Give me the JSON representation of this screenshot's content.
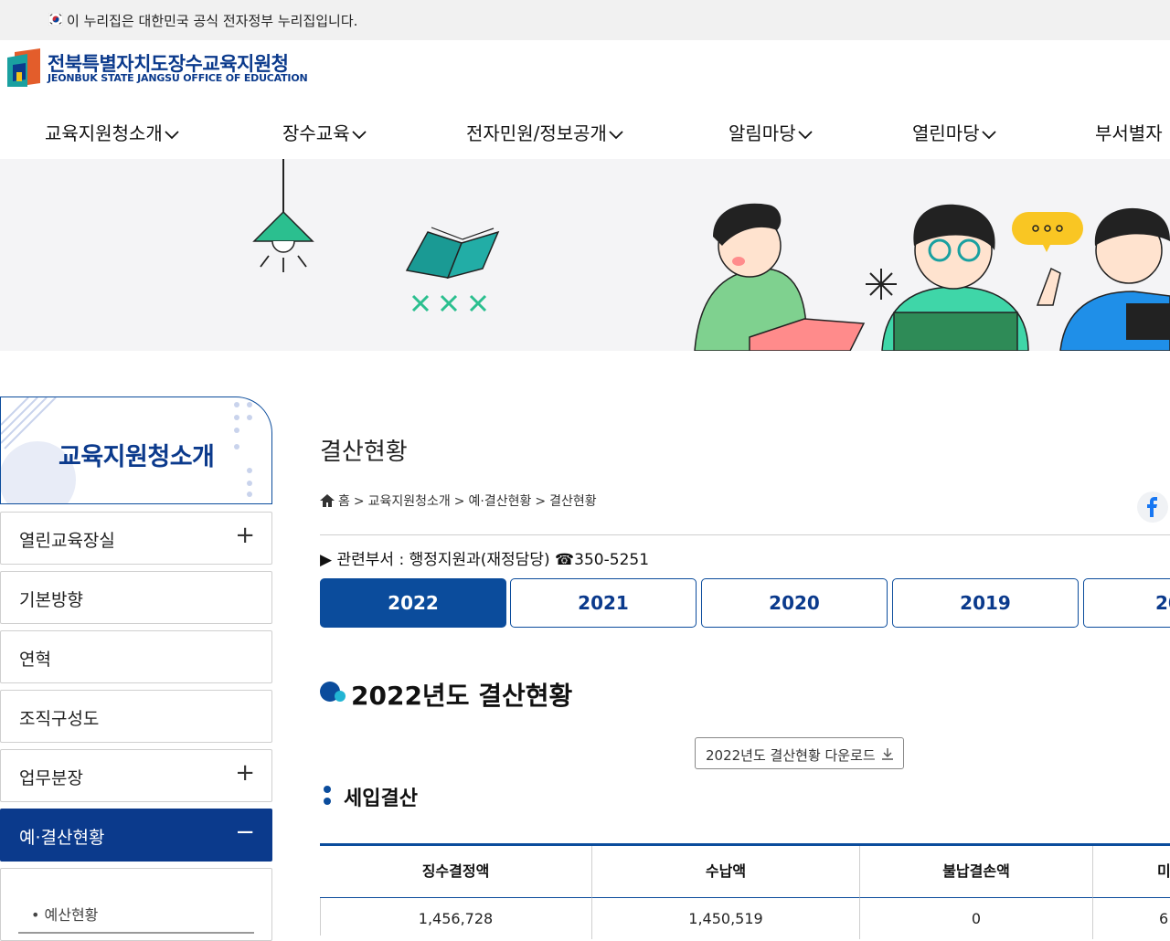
{
  "gov_bar": {
    "text": "이 누리집은 대한민국 공식 전자정부 누리집입니다."
  },
  "logo": {
    "name_ko": "전북특별자치도장수교육지원청",
    "name_en": "JEONBUK STATE JANGSU OFFICE OF EDUCATION"
  },
  "nav": {
    "items": [
      {
        "label": "교육지원청소개"
      },
      {
        "label": "장수교육"
      },
      {
        "label": "전자민원/정보공개"
      },
      {
        "label": "알림마당"
      },
      {
        "label": "열린마당"
      },
      {
        "label": "부서별자"
      }
    ]
  },
  "sidebar": {
    "title": "교육지원청소개",
    "items": [
      {
        "label": "열린교육장실",
        "toggle": "+"
      },
      {
        "label": "기본방향",
        "toggle": ""
      },
      {
        "label": "연혁",
        "toggle": ""
      },
      {
        "label": "조직구성도",
        "toggle": ""
      },
      {
        "label": "업무분장",
        "toggle": "+"
      },
      {
        "label": "예·결산현황",
        "toggle": "−"
      }
    ],
    "sub_items": [
      {
        "label": "• 예산현황"
      }
    ]
  },
  "content": {
    "page_title": "결산현황",
    "breadcrumb": [
      "홈",
      ">",
      "교육지원청소개",
      ">",
      "예·결산현황",
      ">",
      "결산현황"
    ],
    "department": "▶ 관련부서 : 행정지원과(재정담당) ☎350-5251",
    "year_tabs": [
      "2022",
      "2021",
      "2020",
      "2019",
      "20"
    ],
    "active_year": "2022",
    "section_title": "2022년도 결산현황",
    "download_label": "2022년도 결산현황 다운로드",
    "subsection_title": "세입결산",
    "table": {
      "headers": [
        "징수결정액",
        "수납액",
        "불납결손액",
        "미"
      ],
      "rows": [
        [
          "1,456,728",
          "1,450,519",
          "0",
          "6"
        ]
      ]
    }
  },
  "colors": {
    "primary": "#0b3a8c",
    "accent": "#0b4c9c",
    "gov_bar_bg": "#f1f1f1",
    "banner_bg": "#f4f4f6"
  }
}
